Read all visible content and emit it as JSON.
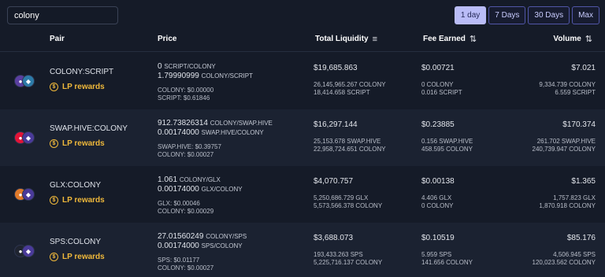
{
  "search": {
    "value": "colony"
  },
  "periods": [
    "1 day",
    "7 Days",
    "30 Days",
    "Max"
  ],
  "active_period": "1 day",
  "headers": {
    "pair": "Pair",
    "price": "Price",
    "liquidity": "Total Liquidity",
    "fee": "Fee Earned",
    "volume": "Volume"
  },
  "rows": [
    {
      "pair": "COLONY:SCRIPT",
      "lp": "LP rewards",
      "price1": "0",
      "price1_unit": "SCRIPT/COLONY",
      "price2": "1.79990999",
      "price2_unit": "COLONY/SCRIPT",
      "usd1": "COLONY: $0.00000",
      "usd2": "SCRIPT: $0.61846",
      "liq": "$19,685.863",
      "liq1": "26,145,965.267 COLONY",
      "liq2": "18,414.658 SCRIPT",
      "fee": "$0.00721",
      "fee1": "0 COLONY",
      "fee2": "0.016 SCRIPT",
      "vol": "$7.021",
      "vol1": "9,334.739 COLONY",
      "vol2": "6.559 SCRIPT",
      "logo_a": "#5a3fa0",
      "logo_b": "#2c7ba8"
    },
    {
      "pair": "SWAP.HIVE:COLONY",
      "lp": "LP rewards",
      "price1": "912.73826314",
      "price1_unit": "COLONY/SWAP.HIVE",
      "price2": "0.00174000",
      "price2_unit": "SWAP.HIVE/COLONY",
      "usd1": "SWAP.HIVE: $0.39757",
      "usd2": "COLONY: $0.00027",
      "liq": "$16,297.144",
      "liq1": "25,153.678 SWAP.HIVE",
      "liq2": "22,958,724.651 COLONY",
      "fee": "$0.23885",
      "fee1": "0.156 SWAP.HIVE",
      "fee2": "458.595 COLONY",
      "vol": "$170.374",
      "vol1": "261.702 SWAP.HIVE",
      "vol2": "240,739.947 COLONY",
      "logo_a": "#e31337",
      "logo_b": "#4a3a9a"
    },
    {
      "pair": "GLX:COLONY",
      "lp": "LP rewards",
      "price1": "1.061",
      "price1_unit": "COLONY/GLX",
      "price2": "0.00174000",
      "price2_unit": "GLX/COLONY",
      "usd1": "GLX: $0.00046",
      "usd2": "COLONY: $0.00029",
      "liq": "$4,070.757",
      "liq1": "5,250,686.729 GLX",
      "liq2": "5,573,566.378 COLONY",
      "fee": "$0.00138",
      "fee1": "4.406 GLX",
      "fee2": "0 COLONY",
      "vol": "$1.365",
      "vol1": "1,757.823 GLX",
      "vol2": "1,870.918 COLONY",
      "logo_a": "#e07a2a",
      "logo_b": "#4a3a9a"
    },
    {
      "pair": "SPS:COLONY",
      "lp": "LP rewards",
      "price1": "27.01560249",
      "price1_unit": "COLONY/SPS",
      "price2": "0.00174000",
      "price2_unit": "SPS/COLONY",
      "usd1": "SPS: $0.01177",
      "usd2": "COLONY: $0.00027",
      "liq": "$3,688.073",
      "liq1": "193,433.263 SPS",
      "liq2": "5,225,716.137 COLONY",
      "fee": "$0.10519",
      "fee1": "5.959 SPS",
      "fee2": "141.656 COLONY",
      "vol": "$85.176",
      "vol1": "4,506.945 SPS",
      "vol2": "120,023.562 COLONY",
      "logo_a": "#1f2430",
      "logo_b": "#4a3a9a"
    }
  ]
}
